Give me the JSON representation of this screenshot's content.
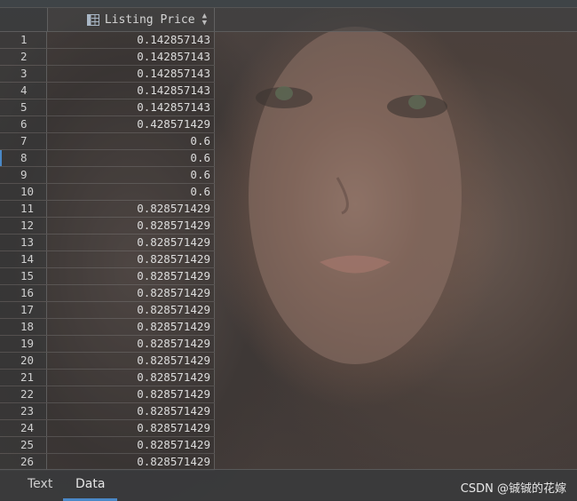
{
  "table": {
    "column_header": "Listing Price",
    "rows": [
      {
        "n": "1",
        "value": "0.142857143"
      },
      {
        "n": "2",
        "value": "0.142857143"
      },
      {
        "n": "3",
        "value": "0.142857143"
      },
      {
        "n": "4",
        "value": "0.142857143"
      },
      {
        "n": "5",
        "value": "0.142857143"
      },
      {
        "n": "6",
        "value": "0.428571429"
      },
      {
        "n": "7",
        "value": "0.6"
      },
      {
        "n": "8",
        "value": "0.6"
      },
      {
        "n": "9",
        "value": "0.6"
      },
      {
        "n": "10",
        "value": "0.6"
      },
      {
        "n": "11",
        "value": "0.828571429"
      },
      {
        "n": "12",
        "value": "0.828571429"
      },
      {
        "n": "13",
        "value": "0.828571429"
      },
      {
        "n": "14",
        "value": "0.828571429"
      },
      {
        "n": "15",
        "value": "0.828571429"
      },
      {
        "n": "16",
        "value": "0.828571429"
      },
      {
        "n": "17",
        "value": "0.828571429"
      },
      {
        "n": "18",
        "value": "0.828571429"
      },
      {
        "n": "19",
        "value": "0.828571429"
      },
      {
        "n": "20",
        "value": "0.828571429"
      },
      {
        "n": "21",
        "value": "0.828571429"
      },
      {
        "n": "22",
        "value": "0.828571429"
      },
      {
        "n": "23",
        "value": "0.828571429"
      },
      {
        "n": "24",
        "value": "0.828571429"
      },
      {
        "n": "25",
        "value": "0.828571429"
      },
      {
        "n": "26",
        "value": "0.828571429"
      }
    ]
  },
  "tabs": {
    "text": "Text",
    "data": "Data",
    "active": "Data"
  },
  "watermark": "CSDN @铖铖的花嫁",
  "colors": {
    "accent": "#4a88c7",
    "text": "#dcdcdc"
  },
  "icons": {
    "column_header": "table-icon",
    "sort": "sort-arrows-icon"
  }
}
